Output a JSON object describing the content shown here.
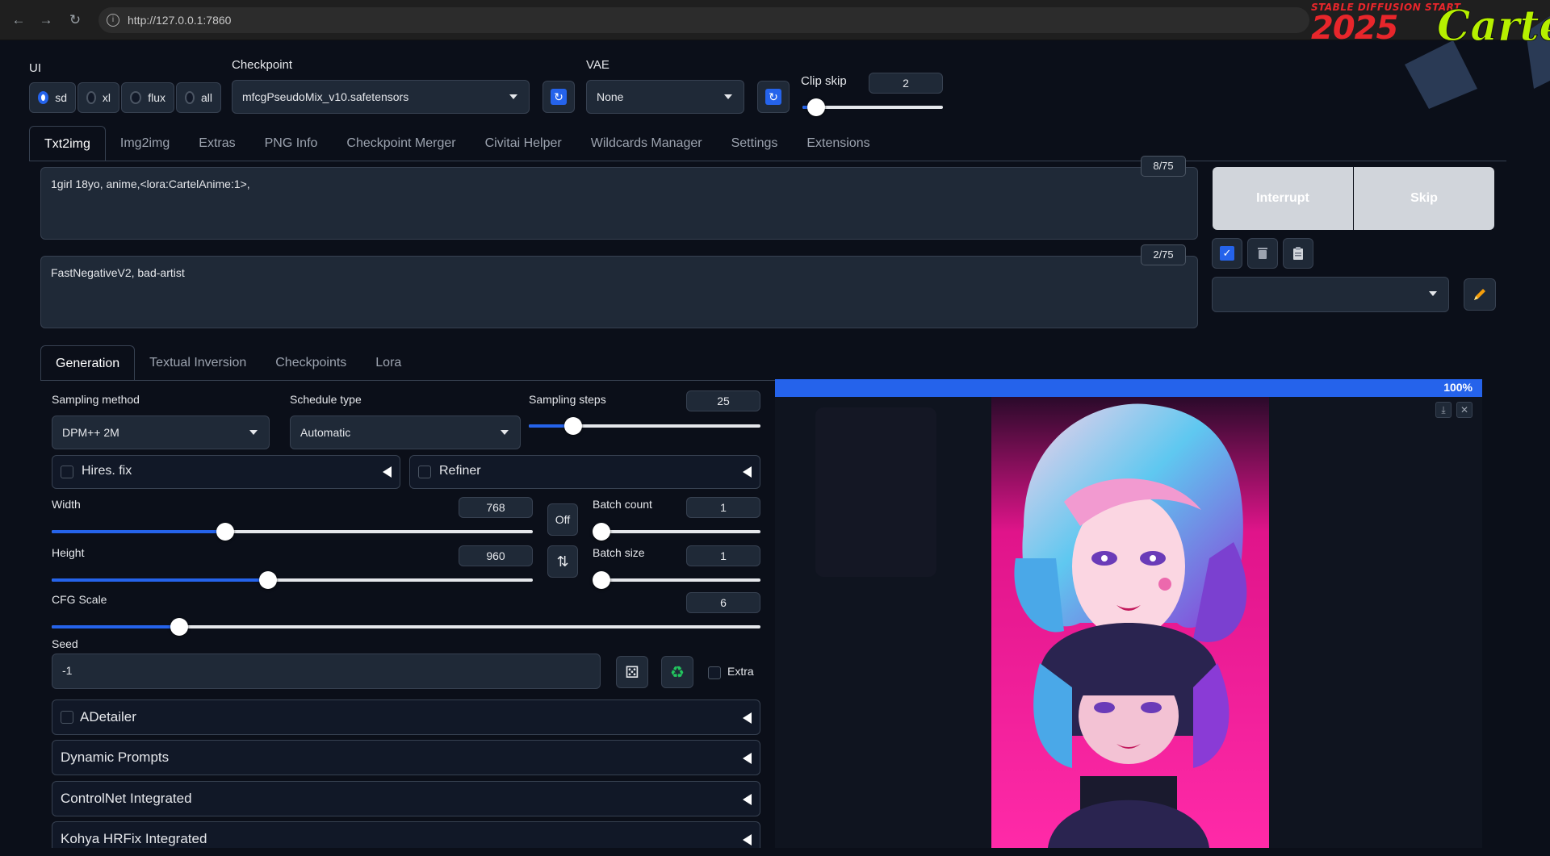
{
  "browser": {
    "url": "http://127.0.0.1:7860"
  },
  "logo": {
    "line1": "STABLE DIFFUSION START",
    "year": "2025",
    "word": "CarteL"
  },
  "ui_selector": {
    "label": "UI",
    "options": [
      {
        "label": "sd",
        "checked": true
      },
      {
        "label": "xl",
        "checked": false
      },
      {
        "label": "flux",
        "checked": false
      },
      {
        "label": "all",
        "checked": false
      }
    ]
  },
  "checkpoint": {
    "label": "Checkpoint",
    "value": "mfcgPseudoMix_v10.safetensors"
  },
  "vae": {
    "label": "VAE",
    "value": "None"
  },
  "clip_skip": {
    "label": "Clip skip",
    "value": "2",
    "fraction": 0.1
  },
  "main_tabs": [
    "Txt2img",
    "Img2img",
    "Extras",
    "PNG Info",
    "Checkpoint Merger",
    "Civitai Helper",
    "Wildcards Manager",
    "Settings",
    "Extensions"
  ],
  "prompt": {
    "text": "1girl 18yo, anime,<lora:CartelAnime:1>,",
    "counter": "8/75"
  },
  "negative_prompt": {
    "text": "FastNegativeV2, bad-artist",
    "counter": "2/75"
  },
  "actions": {
    "interrupt": "Interrupt",
    "skip": "Skip"
  },
  "sub_tabs": [
    "Generation",
    "Textual Inversion",
    "Checkpoints",
    "Lora"
  ],
  "sampling_method": {
    "label": "Sampling method",
    "value": "DPM++ 2M"
  },
  "schedule_type": {
    "label": "Schedule type",
    "value": "Automatic"
  },
  "sampling_steps": {
    "label": "Sampling steps",
    "value": "25",
    "fraction": 0.19
  },
  "hires_fix": {
    "label": "Hires. fix"
  },
  "refiner": {
    "label": "Refiner"
  },
  "width": {
    "label": "Width",
    "value": "768",
    "fraction": 0.36
  },
  "height": {
    "label": "Height",
    "value": "960",
    "fraction": 0.45
  },
  "off_label": "Off",
  "batch_count": {
    "label": "Batch count",
    "value": "1",
    "fraction": 0.0
  },
  "batch_size": {
    "label": "Batch size",
    "value": "1",
    "fraction": 0.0
  },
  "cfg_scale": {
    "label": "CFG Scale",
    "value": "6",
    "fraction": 0.18
  },
  "seed": {
    "label": "Seed",
    "value": "-1",
    "extra_label": "Extra"
  },
  "accordions": [
    "ADetailer",
    "Dynamic Prompts",
    "ControlNet Integrated",
    "Kohya HRFix Integrated"
  ],
  "progress": {
    "text": "100%",
    "value": 100
  }
}
